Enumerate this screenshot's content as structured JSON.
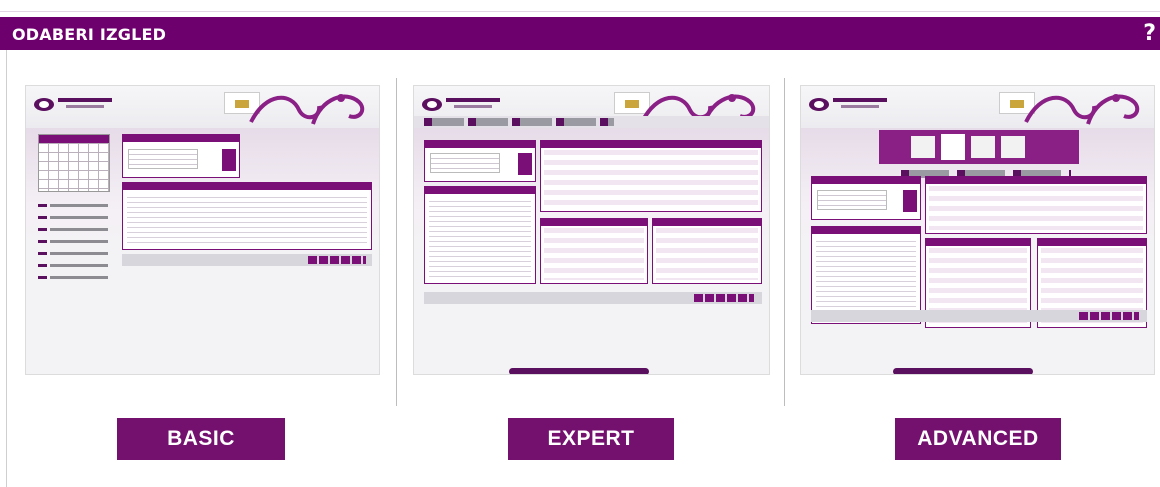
{
  "header": {
    "title": "ODABERI IZGLED",
    "help_label": "?"
  },
  "layouts": [
    {
      "label": "BASIC"
    },
    {
      "label": "EXPERT"
    },
    {
      "label": "ADVANCED"
    }
  ],
  "colors": {
    "brand": "#6e006d",
    "button": "#74116f"
  }
}
